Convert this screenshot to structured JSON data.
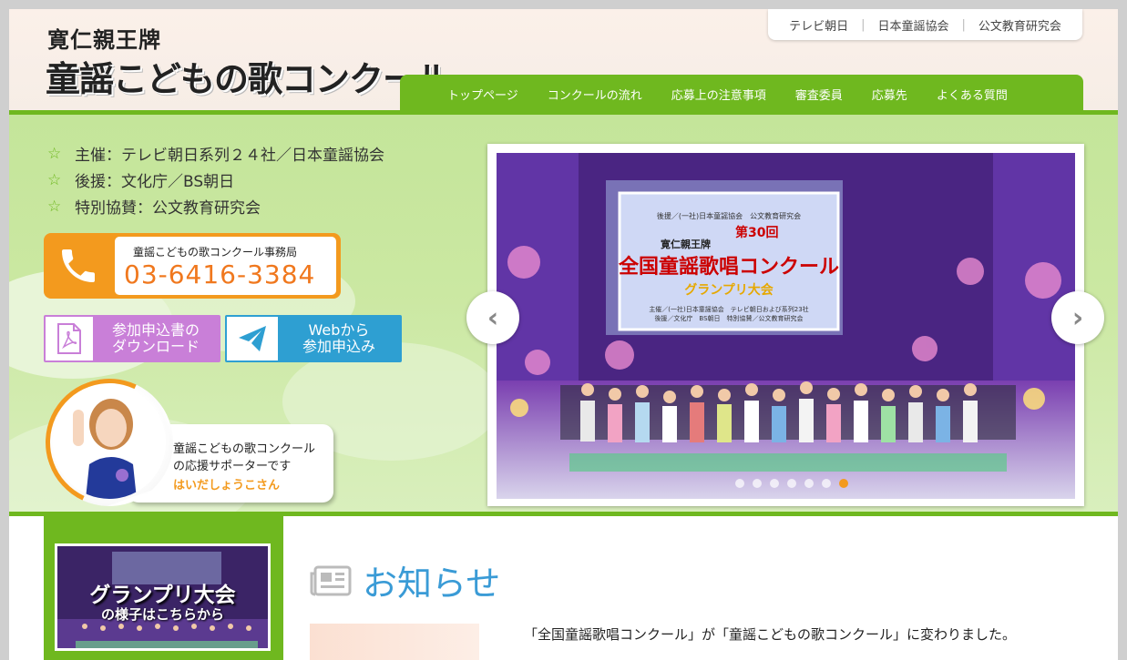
{
  "header": {
    "logo_line1": "寛仁親王牌",
    "logo_line2": "童謡こどもの歌コンクール",
    "top_links": [
      "テレビ朝日",
      "日本童謡協会",
      "公文教育研究会"
    ],
    "nav": [
      "トップページ",
      "コンクールの流れ",
      "応募上の注意事項",
      "審査委員",
      "応募先",
      "よくある質問"
    ]
  },
  "sponsors": [
    "主催：テレビ朝日系列２４社／日本童謡協会",
    "後援：文化庁／BS朝日",
    "特別協賛：公文教育研究会"
  ],
  "contact": {
    "office": "童謡こどもの歌コンクール事務局",
    "phone": "03-6416-3384",
    "phone_icon": "phone-icon"
  },
  "buttons": {
    "download": "参加申込書の\nダウンロード",
    "download_icon": "pdf-icon",
    "web": "Webから\n参加申込み",
    "web_icon": "paper-plane-icon"
  },
  "supporter": {
    "line1": "童謡こどもの歌コンクール",
    "line2": "の応援サポーターです",
    "name": "はいだしょうこさん"
  },
  "slider": {
    "prev": "‹",
    "next": "›",
    "dot_count": 7,
    "active_dot": 6,
    "banner_lines": [
      "後援／(一社)日本童謡協会　公文教育研究会",
      "寛仁親王牌",
      "第30回",
      "全国童謡歌唱コンクール",
      "グランプリ大会",
      "主催／(一社)日本童謡協会　テレビ朝日および系列23社",
      "後援／文化庁　BS朝日　特別協賛／公文教育研究会"
    ]
  },
  "sidebar_banner": {
    "title": "グランプリ大会",
    "subtitle": "の様子はこちらから"
  },
  "news": {
    "title": "お知らせ",
    "first_item": "「全国童謡歌唱コンクール」が「童謡こどもの歌コンクール」に変わりました。"
  },
  "colors": {
    "green": "#6fb81f",
    "orange": "#f39a1e",
    "purple": "#c97fd8",
    "blue": "#2e9fd2",
    "news_blue": "#3a9bd6"
  }
}
